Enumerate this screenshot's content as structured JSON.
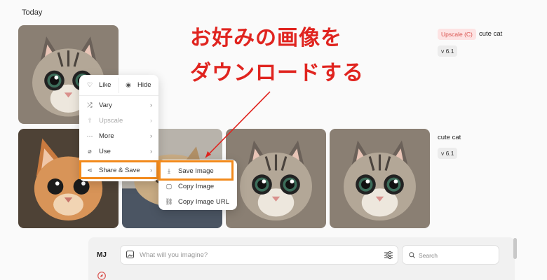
{
  "section_title": "Today",
  "annotation": {
    "line1": "お好みの画像を",
    "line2": "ダウンロードする",
    "color": "#e0241f"
  },
  "job1": {
    "badge": "Upscale (C)",
    "prompt": "cute cat",
    "version": "v 6.1"
  },
  "job2": {
    "prompt": "cute cat",
    "version": "v 6.1"
  },
  "context_menu": {
    "like": "Like",
    "hide": "Hide",
    "vary": "Vary",
    "upscale": "Upscale",
    "more": "More",
    "use": "Use",
    "share_save": "Share & Save"
  },
  "submenu": {
    "save_image": "Save Image",
    "copy_image": "Copy Image",
    "copy_image_url": "Copy Image URL"
  },
  "bottom_bar": {
    "logo": "MJ",
    "imagine_placeholder": "What will you imagine?",
    "search_placeholder": "Search"
  },
  "colors": {
    "highlight": "#f28a1c",
    "badge_bg": "#fde3e3",
    "badge_text": "#d9534f"
  }
}
